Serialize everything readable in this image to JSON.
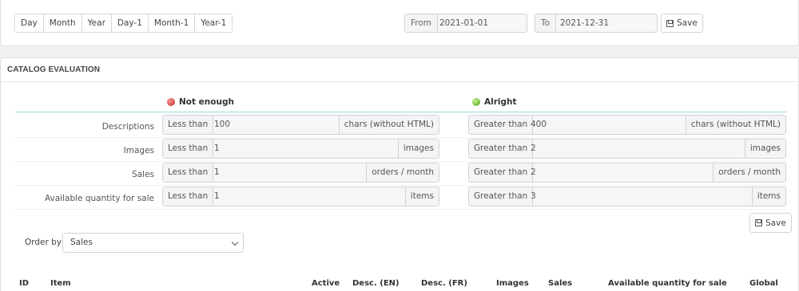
{
  "date_range": {
    "presets": [
      "Day",
      "Month",
      "Year",
      "Day-1",
      "Month-1",
      "Year-1"
    ],
    "from_label": "From",
    "from_value": "2021-01-01",
    "to_label": "To",
    "to_value": "2021-12-31",
    "save_label": "Save"
  },
  "catalog": {
    "title": "CATALOG EVALUATION",
    "not_enough_label": "Not enough",
    "alright_label": "Alright",
    "criteria": [
      {
        "label": "Descriptions",
        "low_prefix": "Less than",
        "low_value": "100",
        "low_suffix": "chars (without HTML)",
        "high_prefix": "Greater than",
        "high_value": "400",
        "high_suffix": "chars (without HTML)"
      },
      {
        "label": "Images",
        "low_prefix": "Less than",
        "low_value": "1",
        "low_suffix": "images",
        "high_prefix": "Greater than",
        "high_value": "2",
        "high_suffix": "images"
      },
      {
        "label": "Sales",
        "low_prefix": "Less than",
        "low_value": "1",
        "low_suffix": "orders / month",
        "high_prefix": "Greater than",
        "high_value": "2",
        "high_suffix": "orders / month"
      },
      {
        "label": "Available quantity for sale",
        "low_prefix": "Less than",
        "low_value": "1",
        "low_suffix": "items",
        "high_prefix": "Greater than",
        "high_value": "3",
        "high_suffix": "items"
      }
    ],
    "save_label": "Save",
    "order_by_label": "Order by",
    "order_by_value": "Sales",
    "columns": [
      "ID",
      "Item",
      "Active",
      "Desc. (EN)",
      "Desc. (FR)",
      "Images",
      "Sales",
      "Available quantity for sale",
      "Global"
    ]
  },
  "colors": {
    "not_enough": "#d9534f",
    "alright": "#7cc142",
    "accent_line": "#9ed4df"
  }
}
